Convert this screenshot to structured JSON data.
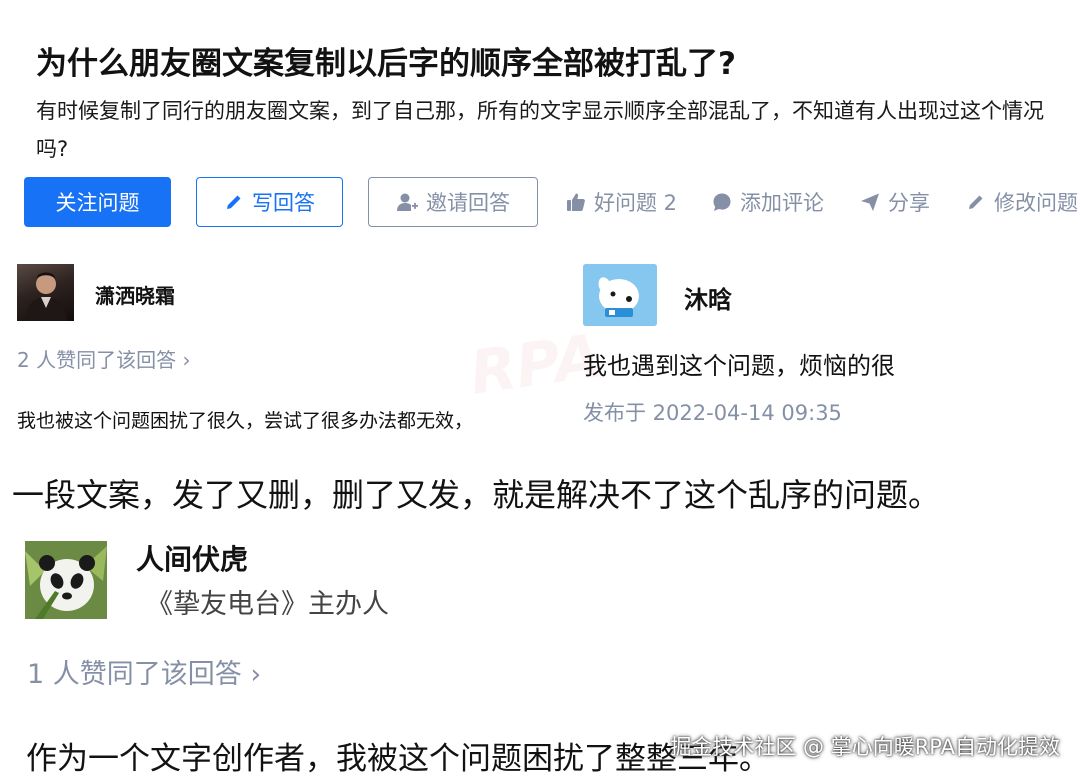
{
  "question": {
    "title": "为什么朋友圈文案复制以后字的顺序全部被打乱了?",
    "description": "有时候复制了同行的朋友圈文案，到了自己那，所有的文字显示顺序全部混乱了，不知道有人出现过这个情况吗?"
  },
  "actions": {
    "follow_label": "关注问题",
    "answer_label": "写回答",
    "invite_label": "邀请回答",
    "good_question_label": "好问题 2",
    "comment_label": "添加评论",
    "share_label": "分享",
    "edit_label": "修改问题"
  },
  "answers": [
    {
      "author": "潇洒晓霜",
      "votes": "2 人赞同了该回答 ›",
      "text": "我也被这个问题困扰了很久，尝试了很多办法都无效，"
    },
    {
      "author": "沐晗",
      "text": "我也遇到这个问题，烦恼的很",
      "date": "发布于 2022-04-14 09:35"
    },
    {
      "author": "人间伏虎",
      "subtitle": "《挚友电台》主办人",
      "votes": "1 人赞同了该回答 ›",
      "text": "作为一个文字创作者，我被这个问题困扰了整整三年。"
    }
  ],
  "overlay_text": "一段文案，发了又删，删了又发，就是解决不了这个乱序的问题。",
  "watermark": "掘金技术社区 @ 掌心向暖RPA自动化提效",
  "colors": {
    "accent": "#1772f6",
    "muted": "#8590a6"
  }
}
